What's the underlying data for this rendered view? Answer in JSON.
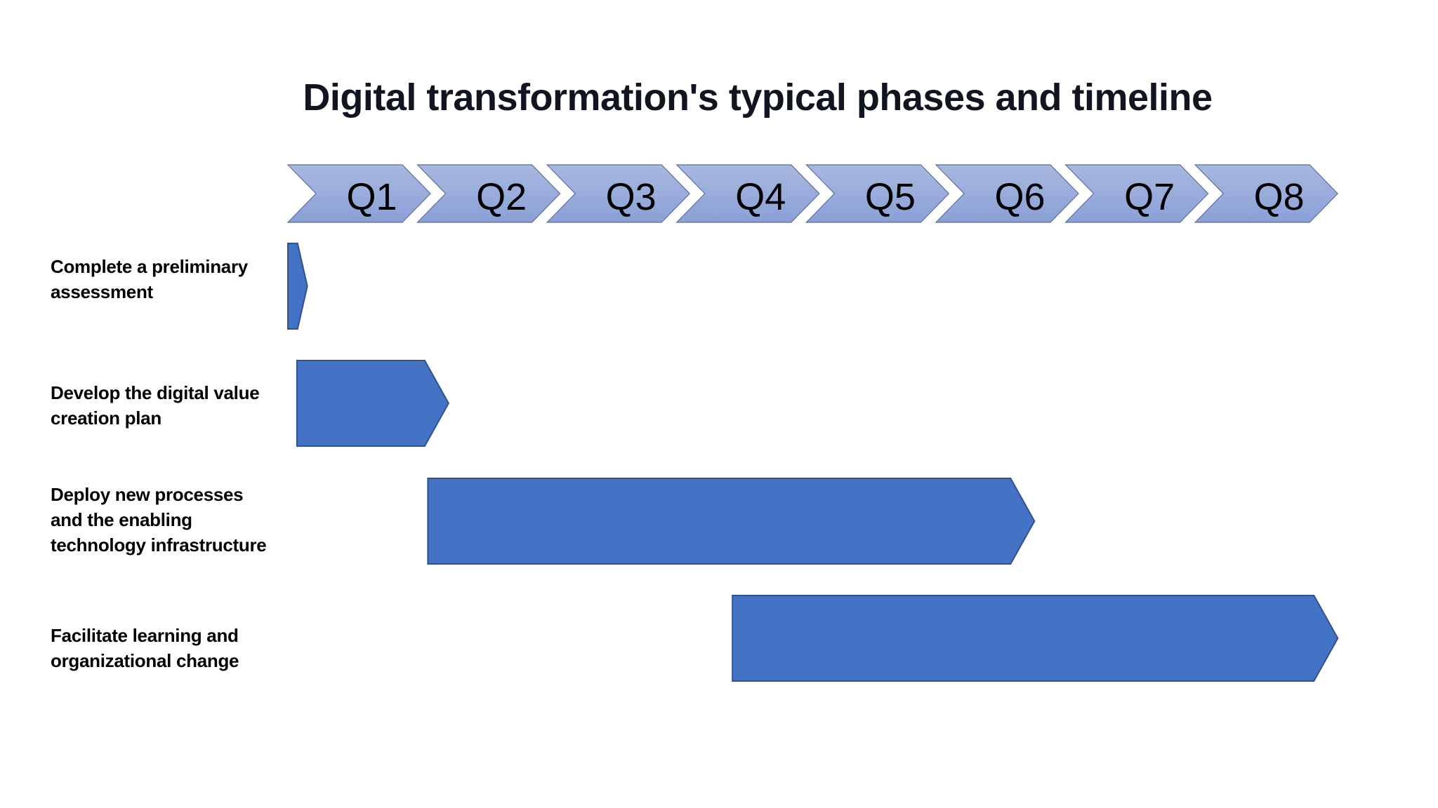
{
  "title": "Digital transformation's typical phases and timeline",
  "colors": {
    "chevron_fill_top": "#A9B8E0",
    "chevron_fill_bottom": "#8AA0D6",
    "chevron_stroke": "#5B6E9E",
    "bar_fill": "#4472C4",
    "bar_stroke": "#2F528F",
    "title": "#111522"
  },
  "timeline": {
    "quarters": [
      "Q1",
      "Q2",
      "Q3",
      "Q4",
      "Q5",
      "Q6",
      "Q7",
      "Q8"
    ]
  },
  "chart_data": {
    "type": "gantt",
    "title": "Digital transformation's typical phases and timeline",
    "unit": "quarters",
    "categories": [
      "Q1",
      "Q2",
      "Q3",
      "Q4",
      "Q5",
      "Q6",
      "Q7",
      "Q8"
    ],
    "range": [
      0,
      8
    ],
    "phases": [
      {
        "name": "Complete a preliminary assessment",
        "lines": [
          "Complete a preliminary",
          "assessment"
        ],
        "start": 0.0,
        "end": 0.15
      },
      {
        "name": "Develop the digital value creation plan",
        "lines": [
          "Develop the digital value",
          "creation plan"
        ],
        "start": 0.07,
        "end": 1.24
      },
      {
        "name": "Deploy new processes and the enabling technology infrastructure",
        "lines": [
          "Deploy new processes",
          "and the enabling",
          "technology infrastructure"
        ],
        "start": 1.08,
        "end": 5.76
      },
      {
        "name": "Facilitate learning and organizational change",
        "lines": [
          "Facilitate learning and",
          "organizational change"
        ],
        "start": 3.43,
        "end": 8.1
      }
    ]
  }
}
